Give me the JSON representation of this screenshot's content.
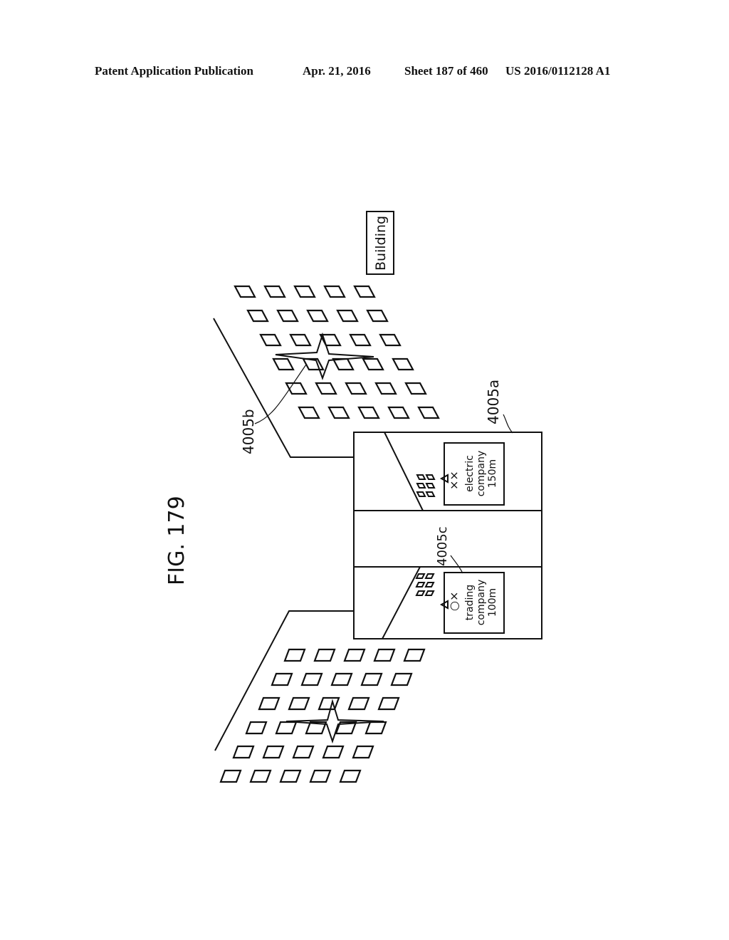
{
  "header": {
    "publication": "Patent Application Publication",
    "date": "Apr. 21, 2016",
    "sheet": "Sheet 187 of 460",
    "number": "US 2016/0112128 A1"
  },
  "figure": {
    "title": "FIG. 179",
    "building_tag": "Building",
    "ref_4005a": "4005a",
    "ref_4005b": "4005b",
    "ref_4005c": "4005c",
    "panel_top": {
      "marks": "××",
      "line1": "electric",
      "line2": "company",
      "line3": "150m"
    },
    "panel_bottom": {
      "marks": "○×",
      "line1": "trading",
      "line2": "company",
      "line3": "100m"
    }
  }
}
